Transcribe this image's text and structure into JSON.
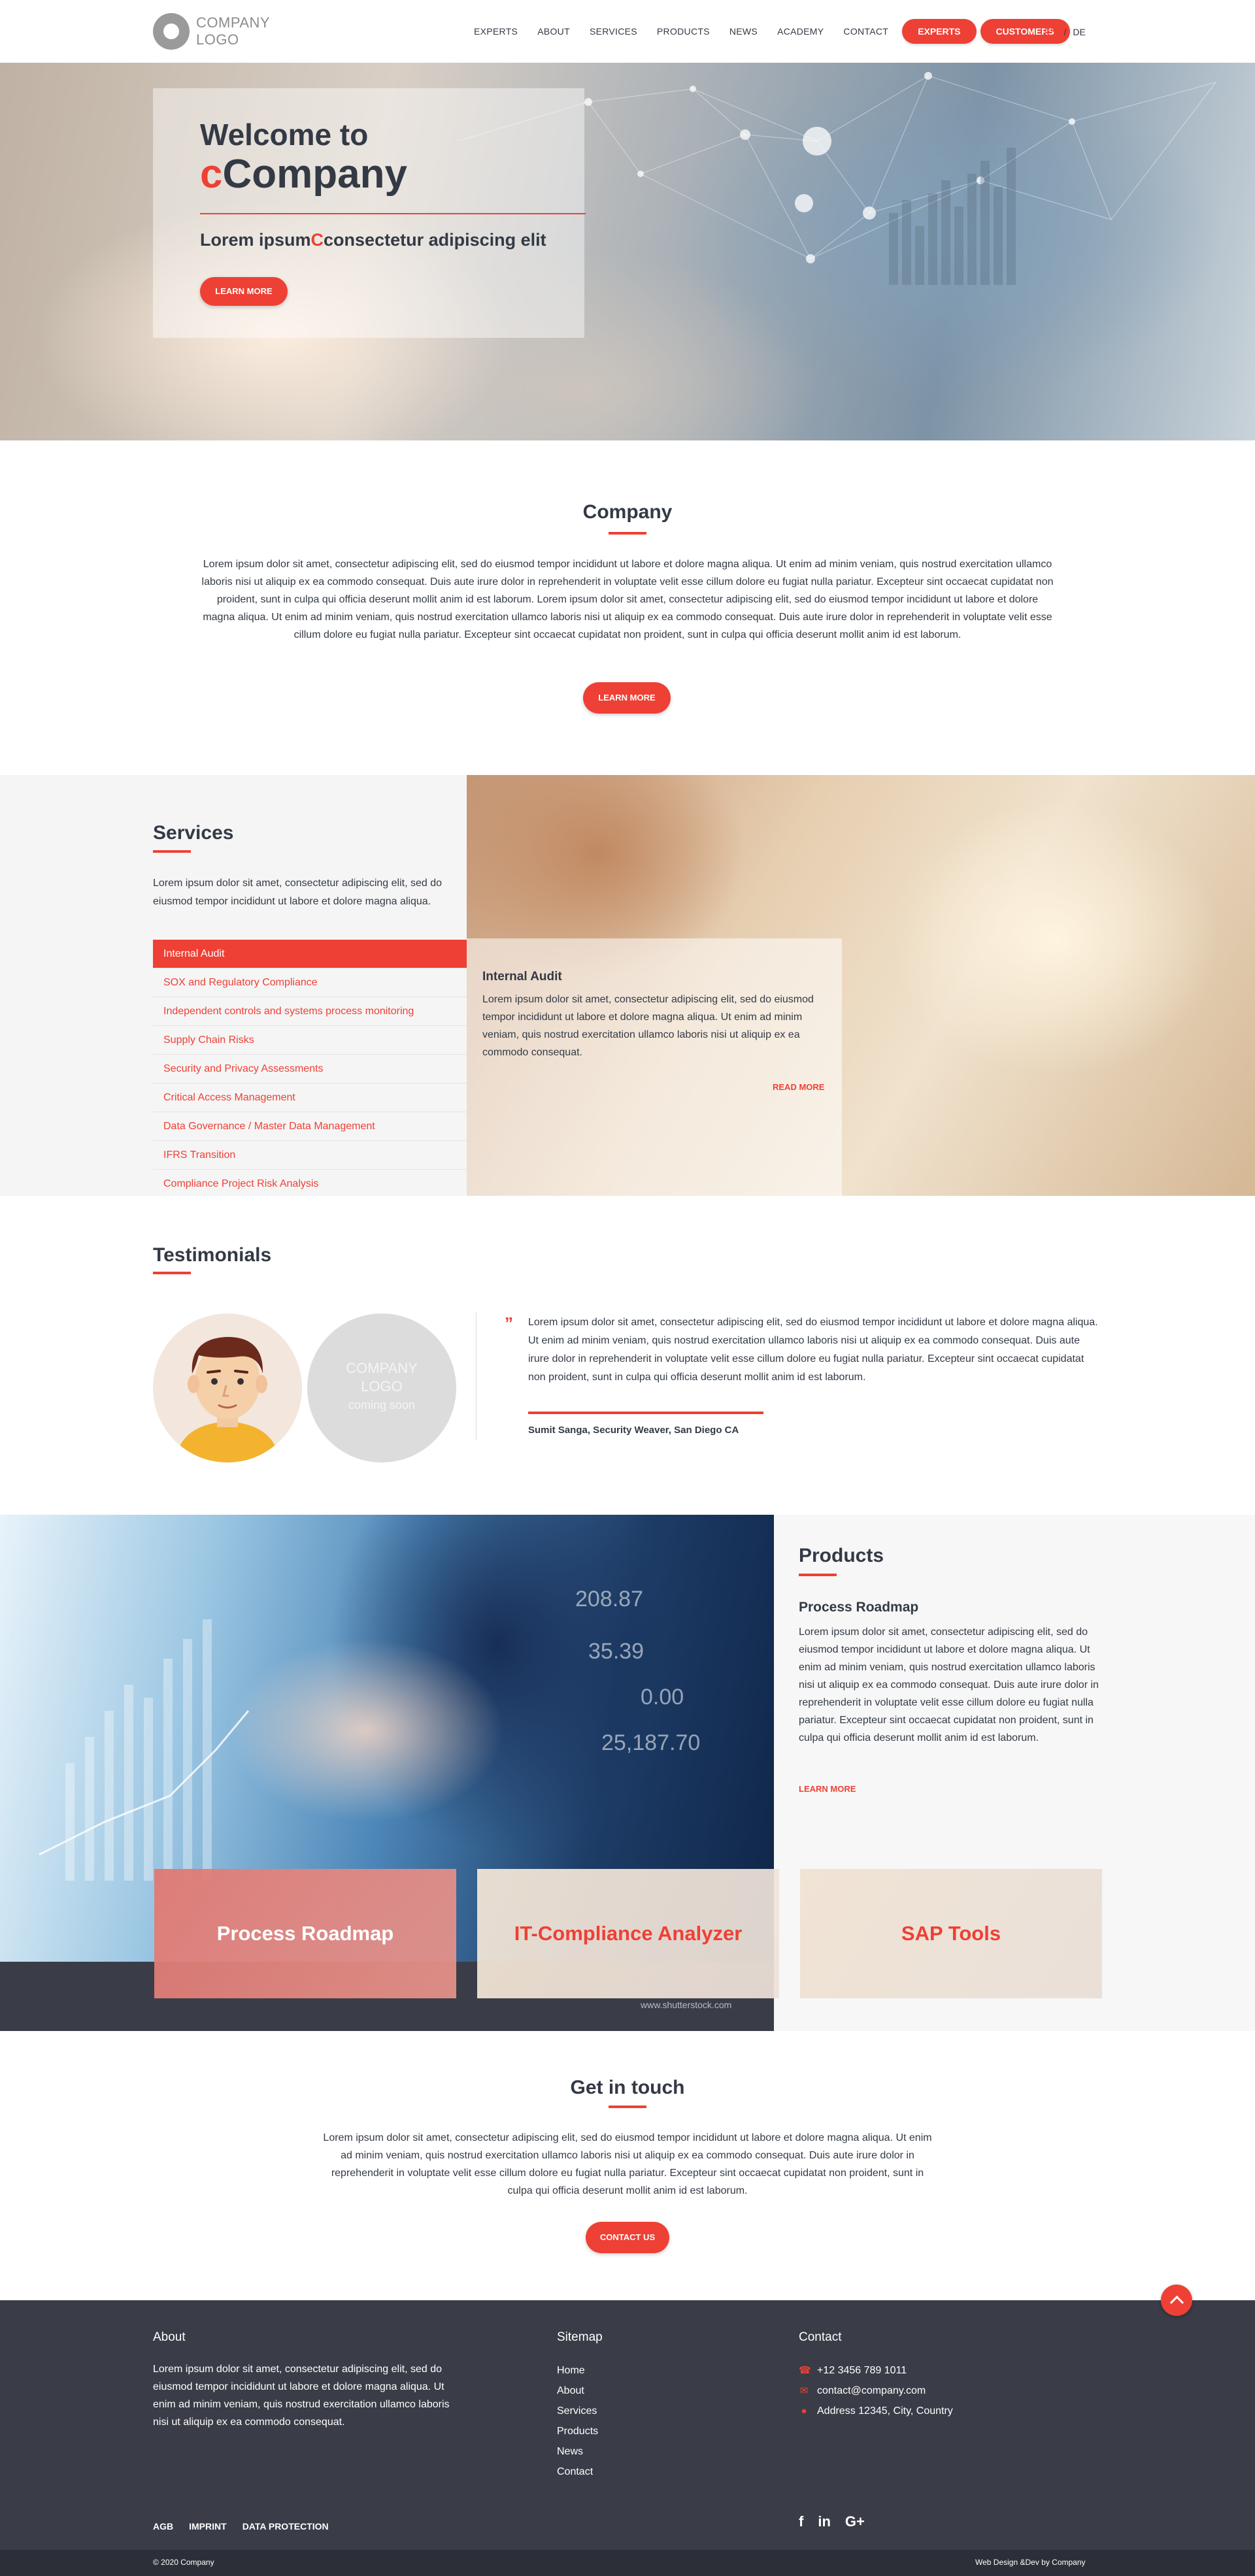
{
  "header": {
    "logo_line1": "COMPANY",
    "logo_line2": "LOGO",
    "nav": [
      "EXPERTS",
      "ABOUT",
      "SERVICES",
      "PRODUCTS",
      "NEWS",
      "ACADEMY",
      "CONTACT"
    ],
    "pill_experts": "EXPERTS",
    "pill_customers": "CUSTOMERS",
    "lang_en": "EN",
    "lang_sep": "/",
    "lang_de": "DE"
  },
  "hero": {
    "welcome": "Welcome to",
    "brand_c": "c",
    "brand_rest": "Company",
    "sub_a": "Lorem ipsum",
    "sub_c": "C",
    "sub_b": "consectetur adipiscing elit",
    "button": "LEARN MORE"
  },
  "company": {
    "title": "Company",
    "text": "Lorem ipsum dolor sit amet, consectetur adipiscing elit, sed do eiusmod tempor incididunt ut labore et dolore magna aliqua. Ut enim ad minim veniam, quis nostrud exercitation ullamco laboris nisi ut aliquip ex ea commodo consequat. Duis aute irure dolor in reprehenderit in voluptate velit esse cillum dolore eu fugiat nulla pariatur. Excepteur sint occaecat cupidatat non proident, sunt in culpa qui officia deserunt mollit anim id est laborum. Lorem ipsum dolor sit amet, consectetur adipiscing elit, sed do eiusmod tempor incididunt ut labore et dolore magna aliqua. Ut enim ad minim veniam, quis nostrud exercitation ullamco laboris nisi ut aliquip ex ea commodo consequat. Duis aute irure dolor in reprehenderit in voluptate velit esse cillum dolore eu fugiat nulla pariatur. Excepteur sint occaecat cupidatat non proident, sunt in culpa qui officia deserunt mollit anim id est laborum.",
    "button": "LEARN MORE"
  },
  "services": {
    "title": "Services",
    "intro": "Lorem ipsum dolor sit amet, consectetur adipiscing elit, sed do eiusmod tempor incididunt ut labore et dolore magna aliqua.",
    "items": [
      "Internal Audit",
      "SOX and Regulatory Compliance",
      "Independent controls and systems process monitoring",
      "Supply Chain Risks",
      "Security and Privacy Assessments",
      "Critical Access Management",
      "Data Governance / Master Data Management",
      "IFRS Transition",
      "Compliance Project Risk Analysis"
    ],
    "card_title": "Internal Audit",
    "card_text": "Lorem ipsum dolor sit amet, consectetur adipiscing elit, sed do eiusmod tempor incididunt ut labore et dolore magna aliqua. Ut enim ad minim veniam, quis nostrud exercitation ullamco laboris nisi ut aliquip ex ea commodo consequat.",
    "card_more": "READ MORE"
  },
  "testimonials": {
    "title": "Testimonials",
    "logo_line1": "COMPANY",
    "logo_line2": "LOGO",
    "coming_soon": "coming soon",
    "quote_mark": "”",
    "text": "Lorem ipsum dolor sit amet, consectetur adipiscing elit, sed do eiusmod tempor incididunt ut labore et dolore magna aliqua. Ut enim ad minim veniam, quis nostrud exercitation ullamco laboris nisi ut aliquip ex ea commodo consequat. Duis aute irure dolor in reprehenderit in voluptate velit esse cillum dolore eu fugiat nulla pariatur. Excepteur sint occaecat cupidatat non proident, sunt in culpa qui officia deserunt mollit anim id est laborum.",
    "author": "Sumit Sanga, Security Weaver, San Diego CA"
  },
  "products": {
    "title": "Products",
    "subtitle": "Process Roadmap",
    "text": "Lorem ipsum dolor sit amet, consectetur adipiscing elit, sed do eiusmod tempor incididunt ut labore et dolore magna aliqua. Ut enim ad minim veniam, quis nostrud exercitation ullamco laboris nisi ut aliquip ex ea commodo consequat. Duis aute irure dolor in reprehenderit in voluptate velit esse cillum dolore eu fugiat nulla pariatur. Excepteur sint occaecat cupidatat non proident, sunt in culpa qui officia deserunt mollit anim id est laborum.",
    "more": "LEARN MORE",
    "tiles": [
      "Process Roadmap",
      "IT-Compliance Analyzer",
      "SAP Tools"
    ],
    "watermark": "www.shutterstock.com"
  },
  "contact": {
    "title": "Get in touch",
    "text": "Lorem ipsum dolor sit amet, consectetur adipiscing elit, sed do eiusmod tempor incididunt ut labore et dolore magna aliqua. Ut enim ad minim veniam, quis nostrud exercitation ullamco laboris nisi ut aliquip ex ea commodo consequat. Duis aute irure dolor in reprehenderit in voluptate velit esse cillum dolore eu fugiat nulla pariatur. Excepteur sint occaecat cupidatat non proident, sunt in culpa qui officia deserunt mollit anim id est laborum.",
    "button": "CONTACT US"
  },
  "footer": {
    "about_title": "About",
    "about_text": "Lorem ipsum dolor sit amet, consectetur adipiscing elit, sed do eiusmod tempor incididunt ut labore et dolore magna aliqua. Ut enim ad minim veniam, quis nostrud exercitation ullamco laboris nisi ut aliquip ex ea commodo consequat.",
    "sitemap_title": "Sitemap",
    "sitemap": [
      "Home",
      "About",
      "Services",
      "Products",
      "News",
      "Contact"
    ],
    "contact_title": "Contact",
    "phone": "+12 3456 789 1011",
    "email": "contact@company.com",
    "address": "Address 12345, City, Country",
    "legal": [
      "AGB",
      "IMPRINT",
      "DATA PROTECTION"
    ],
    "social": [
      "f",
      "in",
      "G+"
    ],
    "copyright": "© 2020 Company",
    "credit": "Web Design &Dev by Company",
    "icons": [
      "phone-icon",
      "envelope-icon",
      "map-pin-icon",
      "facebook-icon",
      "linkedin-icon",
      "google-plus-icon",
      "arrow-up-icon"
    ],
    "accent_color": "#ee4035"
  }
}
